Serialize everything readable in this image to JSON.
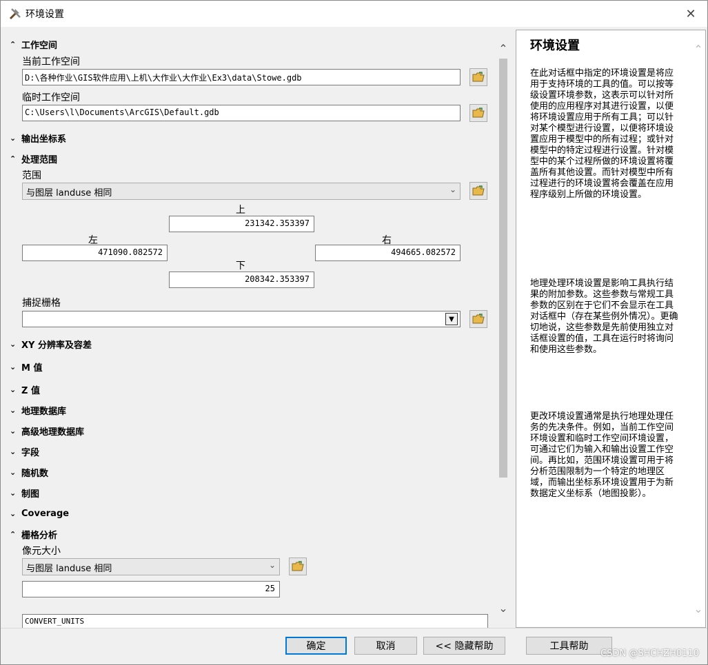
{
  "window": {
    "title": "环境设置"
  },
  "sections": {
    "workspace": {
      "title": "工作空间",
      "current_label": "当前工作空间",
      "current_value": "D:\\各种作业\\GIS软件应用\\上机\\大作业\\大作业\\Ex3\\data\\Stowe.gdb",
      "scratch_label": "临时工作空间",
      "scratch_value": "C:\\Users\\l\\Documents\\ArcGIS\\Default.gdb"
    },
    "output_coords": {
      "title": "输出坐标系"
    },
    "extent": {
      "title": "处理范围",
      "range_label": "范围",
      "range_value": "与图层 landuse 相同",
      "top_label": "上",
      "top_value": "231342.353397",
      "left_label": "左",
      "left_value": "471090.082572",
      "right_label": "右",
      "right_value": "494665.082572",
      "bottom_label": "下",
      "bottom_value": "208342.353397",
      "snap_label": "捕捉栅格",
      "snap_value": ""
    },
    "xy": {
      "title": "XY 分辨率及容差"
    },
    "m": {
      "title": "M 值"
    },
    "z": {
      "title": "Z 值"
    },
    "geodatabase": {
      "title": "地理数据库"
    },
    "adv_geodatabase": {
      "title": "高级地理数据库"
    },
    "fields": {
      "title": "字段"
    },
    "random": {
      "title": "随机数"
    },
    "cartography": {
      "title": "制图"
    },
    "coverage": {
      "title": "Coverage"
    },
    "raster": {
      "title": "栅格分析",
      "cell_label": "像元大小",
      "cell_value": "与图层 landuse 相同",
      "cell_number": "25",
      "convert_units": "CONVERT_UNITS"
    }
  },
  "help": {
    "title": "环境设置",
    "p1": "在此对话框中指定的环境设置是将应用于支持环境的工具的值。可以按等级设置环境参数，这表示可以针对所使用的应用程序对其进行设置，以便将环境设置应用于所有工具；可以针对某个模型进行设置，以便将环境设置应用于模型中的所有过程；或针对模型中的特定过程进行设置。针对模型中的某个过程所做的环境设置将覆盖所有其他设置。而针对模型中所有过程进行的环境设置将会覆盖在应用程序级别上所做的环境设置。",
    "p2": "地理处理环境设置是影响工具执行结果的附加参数。这些参数与常规工具参数的区别在于它们不会显示在工具对话框中（存在某些例外情况）。更确切地说，这些参数是先前使用独立对话框设置的值，工具在运行时将询问和使用这些参数。",
    "p3": "更改环境设置通常是执行地理处理任务的先决条件。例如，当前工作空间环境设置和临时工作空间环境设置，可通过它们为输入和输出设置工作空间。再比如，范围环境设置可用于将分析范围限制为一个特定的地理区域，而输出坐标系环境设置用于为新数据定义坐标系（地图投影）。"
  },
  "buttons": {
    "ok": "确定",
    "cancel": "取消",
    "hide_help": "<< 隐藏帮助",
    "tool_help": "工具帮助"
  },
  "watermark": "CSDN @SHCHZH0110"
}
